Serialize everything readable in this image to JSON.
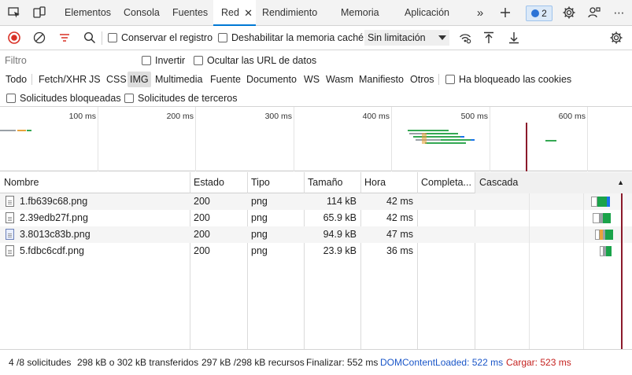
{
  "tabs": {
    "items": [
      "Elementos",
      "Consola",
      "Fuentes",
      "Red",
      "Rendimiento",
      "Memoria",
      "Aplicación"
    ],
    "active": "Red",
    "issues_count": "2"
  },
  "toolbar": {
    "preserve_log": "Conservar el registro",
    "disable_cache": "Deshabilitar la memoria caché",
    "throttle": "Sin limitación"
  },
  "filter": {
    "placeholder": "Filtro",
    "invert": "Invertir",
    "hide_data_urls": "Ocultar las URL de datos",
    "types": [
      "Todo",
      "Fetch/XHR",
      "JS",
      "CSS",
      "IMG",
      "Multimedia",
      "Fuente",
      "Documento",
      "WS",
      "Wasm",
      "Manifiesto",
      "Otros"
    ],
    "active_type": "IMG",
    "blocked_cookies": "Ha bloqueado las cookies",
    "blocked_requests": "Solicitudes bloqueadas",
    "third_party": "Solicitudes de terceros"
  },
  "overview": {
    "ticks": [
      "100 ms",
      "200 ms",
      "300 ms",
      "400 ms",
      "500 ms",
      "600 ms"
    ]
  },
  "table": {
    "columns": [
      "Nombre",
      "Estado",
      "Tipo",
      "Tamaño",
      "Hora",
      "Completa...",
      "Cascada"
    ],
    "rows": [
      {
        "name": "1.fb639c68.png",
        "status": "200",
        "type": "png",
        "size": "114 kB",
        "time": "42 ms"
      },
      {
        "name": "2.39edb27f.png",
        "status": "200",
        "type": "png",
        "size": "65.9 kB",
        "time": "42 ms"
      },
      {
        "name": "3.8013c83b.png",
        "status": "200",
        "type": "png",
        "size": "94.9 kB",
        "time": "47 ms"
      },
      {
        "name": "5.fdbc6cdf.png",
        "status": "200",
        "type": "png",
        "size": "23.9 kB",
        "time": "36 ms"
      }
    ]
  },
  "statusbar": {
    "requests": "4 /8 solicitudes",
    "transferred": "298 kB o 302 kB transferidos",
    "resources": "297 kB /298 kB recursos",
    "finish": "Finalizar: 552 ms",
    "dcl": "DOMContentLoaded: 522 ms",
    "load": "Cargar: 523 ms",
    "dcl_color": "#1a56c8",
    "load_color": "#c5221f"
  }
}
